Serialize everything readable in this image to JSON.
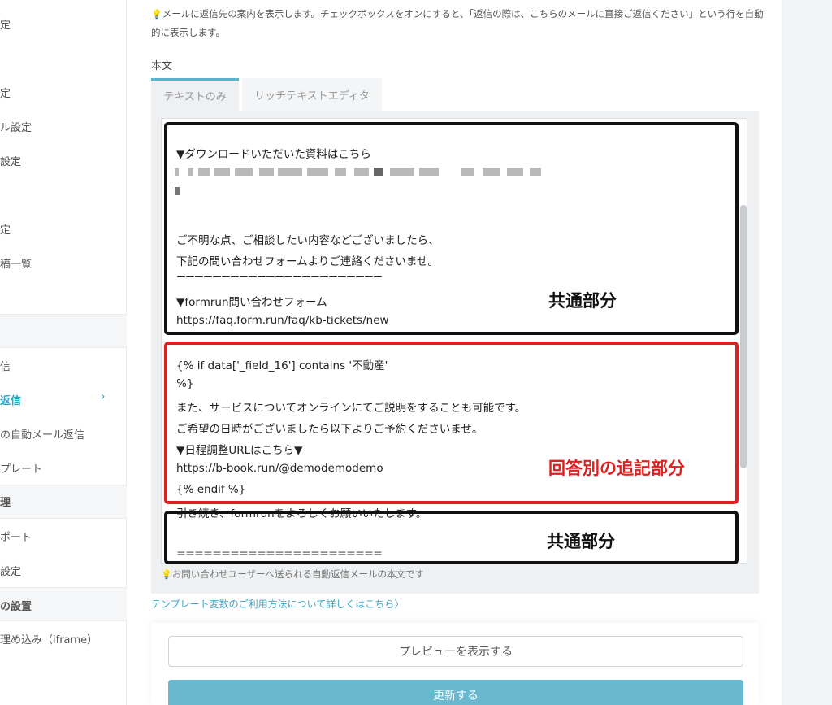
{
  "sidebar": {
    "items": [
      {
        "label": "定"
      },
      {
        "label": "定"
      },
      {
        "label": "ル設定"
      },
      {
        "label": "設定"
      },
      {
        "label": "定"
      },
      {
        "label": "稿一覧"
      },
      {
        "label": "信"
      },
      {
        "label": "返信"
      },
      {
        "label": "の自動メール返信"
      },
      {
        "label": "プレート"
      },
      {
        "label": "理"
      },
      {
        "label": "ポート"
      },
      {
        "label": "設定"
      },
      {
        "label": "の設置"
      },
      {
        "label": "理め込み（iframe）"
      }
    ],
    "active_chevron": "›"
  },
  "main": {
    "hint_top": "メールに返信先の案内を表示します。チェックボックスをオンにすると、「返信の際は、こちらのメールに直接ご返信ください」という行を自動的に表示します。",
    "body_label": "本文",
    "tabs": [
      {
        "label": "テキストのみ"
      },
      {
        "label": "リッチテキストエディタ"
      }
    ],
    "editor_lines": [
      "▼ダウンロードいただいた資料はこちら",
      "ご不明な点、ご相談したい内容などございましたら、",
      "下記の問い合わせフォームよりご連絡くださいませ。",
      "ーーーーーーーーーーーーーーーーーーーーーーー",
      "▼formrun問い合わせフォーム",
      "https://faq.form.run/faq/kb-tickets/new",
      "{% if data['_field_16'] contains '不動産'",
      " %}",
      "また、サービスについてオンラインにてご説明をすることも可能です。",
      "ご希望の日時がございましたら以下よりご予約くださいませ。",
      "▼日程調整URLはこちら▼",
      "https://b-book.run/@demodemodemo",
      "{% endif %}",
      "引き続き、formrunをよろしくお願いいたします。",
      "＝＝＝＝＝＝＝＝＝＝＝＝＝＝＝＝＝＝＝＝＝＝＝"
    ],
    "annotations": {
      "common_1": "共通部分",
      "per_answer": "回答別の追記部分",
      "common_2": "共通部分"
    },
    "annotation_colors": {
      "black": "#111111",
      "red": "#e02020"
    },
    "hint_bottom": "お問い合わせユーザーへ送られる自動返信メールの本文です",
    "template_link": "テンプレート変数のご利用方法について詳しくはこちら〉",
    "preview_button": "プレビューを表示する",
    "update_button": "更新する"
  }
}
